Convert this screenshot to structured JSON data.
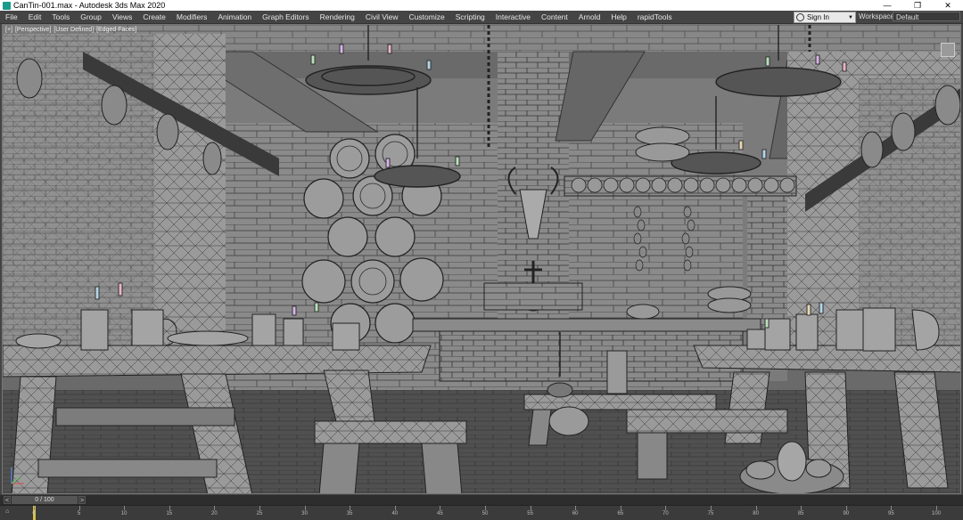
{
  "window": {
    "title": "CanTin-001.max - Autodesk 3ds Max 2020",
    "minimize": "—",
    "maximize": "❐",
    "close": "✕"
  },
  "menu": {
    "items": [
      "File",
      "Edit",
      "Tools",
      "Group",
      "Views",
      "Create",
      "Modifiers",
      "Animation",
      "Graph Editors",
      "Rendering",
      "Civil View",
      "Customize",
      "Scripting",
      "Interactive",
      "Content",
      "Arnold",
      "Help",
      "rapidTools"
    ],
    "sign_in": "Sign In",
    "workspaces_label": "Workspaces:",
    "workspace_value": "Default"
  },
  "viewport": {
    "labels": [
      "[+]",
      "[Perspective]",
      "[User Defined]",
      "[Edged Faces]"
    ]
  },
  "timeslider": {
    "prev": "<",
    "frame": "0 / 100",
    "next": ">"
  },
  "trackbar": {
    "ticks": [
      "0",
      "5",
      "10",
      "15",
      "20",
      "25",
      "30",
      "35",
      "40",
      "45",
      "50",
      "55",
      "60",
      "65",
      "70",
      "75",
      "80",
      "85",
      "90",
      "95",
      "100"
    ],
    "current_frame": 0
  },
  "colors": {
    "viewport_bg": "#5e5e5e",
    "ui_dark": "#444444",
    "playhead": "#d9c24a"
  }
}
